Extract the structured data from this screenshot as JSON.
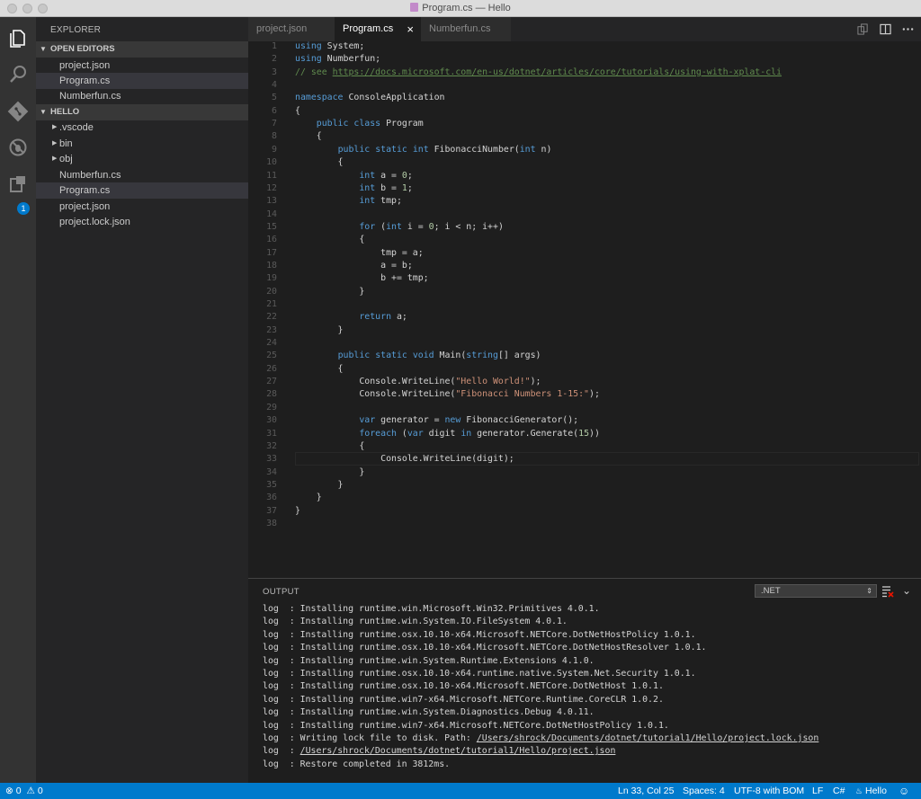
{
  "window": {
    "title": "Program.cs — Hello"
  },
  "activity": {
    "badge": "1"
  },
  "sidebar": {
    "title": "EXPLORER",
    "open_editors_header": "OPEN EDITORS",
    "open_editors": [
      {
        "label": "project.json"
      },
      {
        "label": "Program.cs"
      },
      {
        "label": "Numberfun.cs"
      }
    ],
    "folder_header": "HELLO",
    "items": [
      {
        "label": ".vscode",
        "folder": true
      },
      {
        "label": "bin",
        "folder": true
      },
      {
        "label": "obj",
        "folder": true
      },
      {
        "label": "Numberfun.cs",
        "folder": false
      },
      {
        "label": "Program.cs",
        "folder": false
      },
      {
        "label": "project.json",
        "folder": false
      },
      {
        "label": "project.lock.json",
        "folder": false
      }
    ]
  },
  "tabs": [
    {
      "label": "project.json"
    },
    {
      "label": "Program.cs",
      "close": "×"
    },
    {
      "label": "Numberfun.cs"
    }
  ],
  "editor": {
    "line_numbers": [
      "1",
      "2",
      "3",
      "4",
      "5",
      "6",
      "7",
      "8",
      "9",
      "10",
      "11",
      "12",
      "13",
      "14",
      "15",
      "16",
      "17",
      "18",
      "19",
      "20",
      "21",
      "22",
      "23",
      "24",
      "25",
      "26",
      "27",
      "28",
      "29",
      "30",
      "31",
      "32",
      "33",
      "34",
      "35",
      "36",
      "37",
      "38"
    ],
    "lines": [
      "using System;",
      "using Numberfun;",
      "// see https://docs.microsoft.com/en-us/dotnet/articles/core/tutorials/using-with-xplat-cli",
      "",
      "namespace ConsoleApplication",
      "{",
      "    public class Program",
      "    {",
      "        public static int FibonacciNumber(int n)",
      "        {",
      "            int a = 0;",
      "            int b = 1;",
      "            int tmp;",
      "",
      "            for (int i = 0; i < n; i++)",
      "            {",
      "                tmp = a;",
      "                a = b;",
      "                b += tmp;",
      "            }",
      "",
      "            return a;",
      "        }",
      "",
      "        public static void Main(string[] args)",
      "        {",
      "            Console.WriteLine(\"Hello World!\");",
      "            Console.WriteLine(\"Fibonacci Numbers 1-15:\");",
      "",
      "            var generator = new FibonacciGenerator();",
      "            foreach (var digit in generator.Generate(15))",
      "            {",
      "                Console.WriteLine(digit);",
      "            }",
      "        }",
      "    }",
      "}",
      ""
    ]
  },
  "panel": {
    "title": "OUTPUT",
    "channel": ".NET",
    "lines": [
      "log  : Installing runtime.win.Microsoft.Win32.Primitives 4.0.1.",
      "log  : Installing runtime.win.System.IO.FileSystem 4.0.1.",
      "log  : Installing runtime.osx.10.10-x64.Microsoft.NETCore.DotNetHostPolicy 1.0.1.",
      "log  : Installing runtime.osx.10.10-x64.Microsoft.NETCore.DotNetHostResolver 1.0.1.",
      "log  : Installing runtime.win.System.Runtime.Extensions 4.1.0.",
      "log  : Installing runtime.osx.10.10-x64.runtime.native.System.Net.Security 1.0.1.",
      "log  : Installing runtime.osx.10.10-x64.Microsoft.NETCore.DotNetHost 1.0.1.",
      "log  : Installing runtime.win7-x64.Microsoft.NETCore.Runtime.CoreCLR 1.0.2.",
      "log  : Installing runtime.win.System.Diagnostics.Debug 4.0.11.",
      "log  : Installing runtime.win7-x64.Microsoft.NETCore.DotNetHostPolicy 1.0.1.",
      "log  : Writing lock file to disk. Path: /Users/shrock/Documents/dotnet/tutorial1/Hello/project.lock.json",
      "log  : /Users/shrock/Documents/dotnet/tutorial1/Hello/project.json",
      "log  : Restore completed in 3812ms."
    ]
  },
  "status": {
    "errors": "0",
    "warnings": "0",
    "position": "Ln 33, Col 25",
    "spaces": "Spaces: 4",
    "encoding": "UTF-8 with BOM",
    "eol": "LF",
    "language": "C#",
    "project": "Hello"
  },
  "colors": {
    "accent": "#007acc",
    "keyword": "#569cd6",
    "comment": "#608b4e",
    "string": "#ce9178",
    "number": "#b5cea8"
  }
}
